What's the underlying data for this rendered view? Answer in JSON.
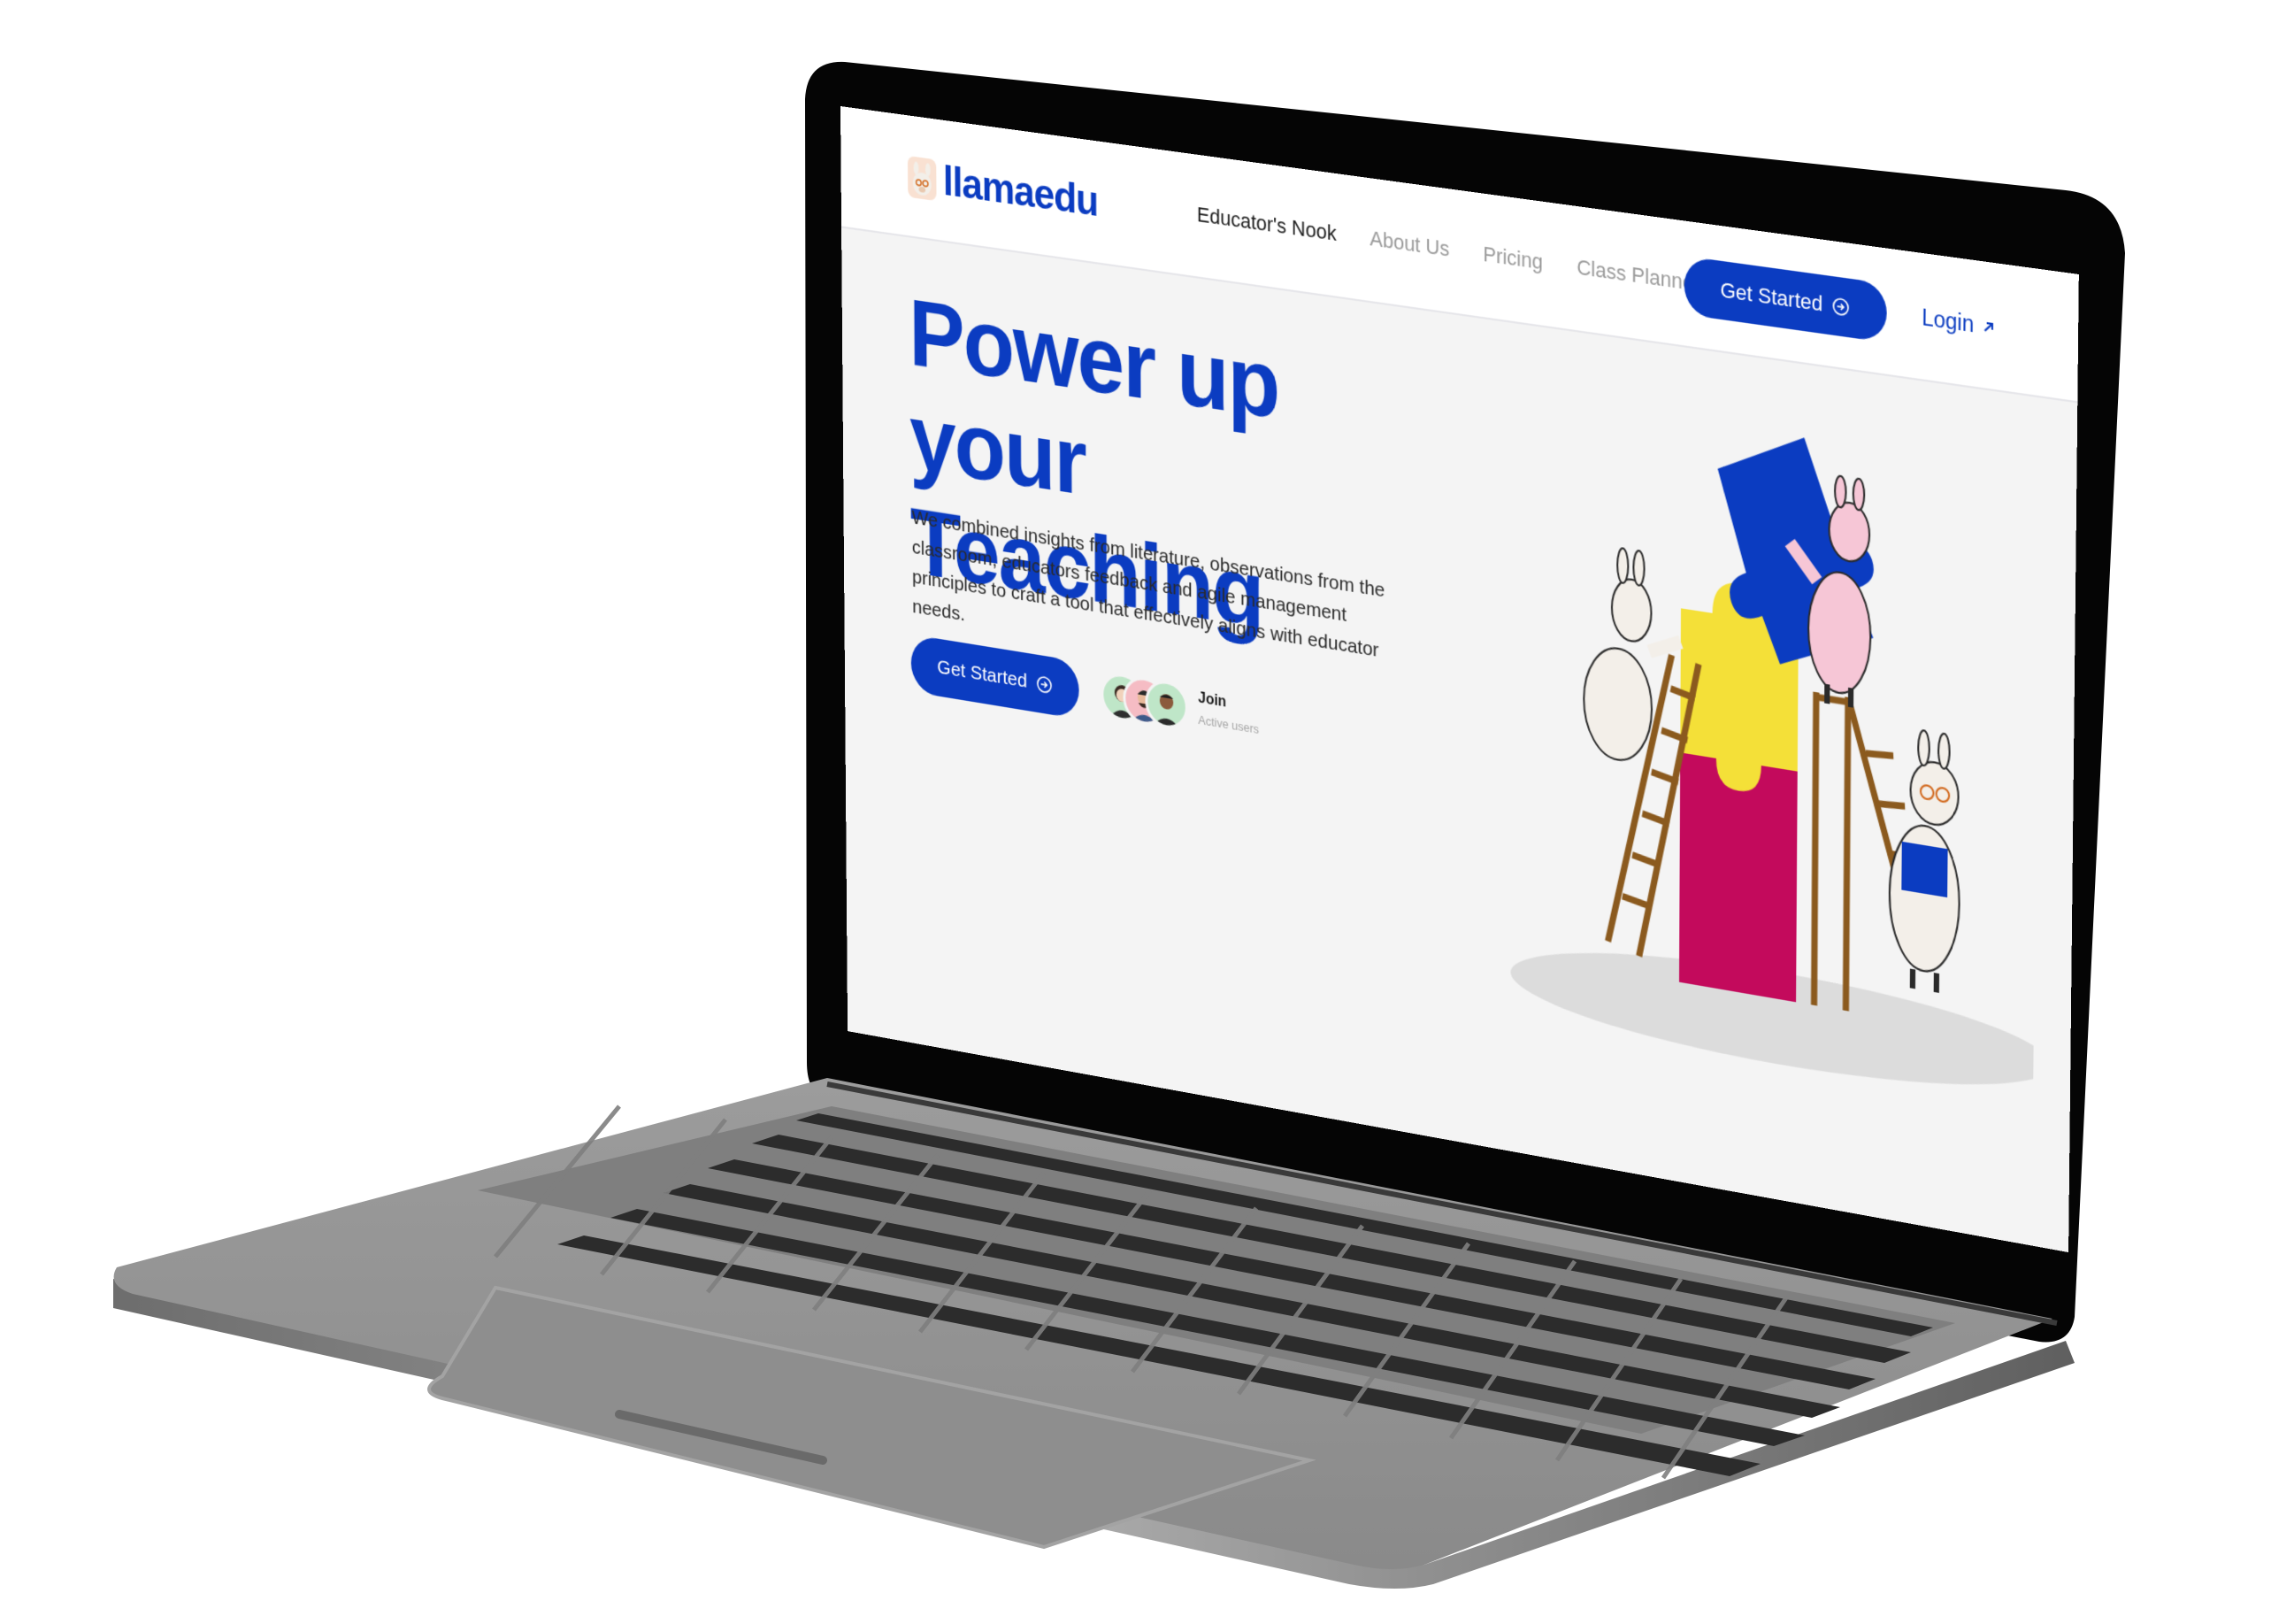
{
  "header": {
    "logo_text": "llamaedu",
    "nav": [
      {
        "label": "Educator's Nook",
        "active": true
      },
      {
        "label": "About Us",
        "active": false
      },
      {
        "label": "Pricing",
        "active": false
      },
      {
        "label": "Class Planner",
        "active": false
      }
    ],
    "get_started_label": "Get Started",
    "login_label": "Login"
  },
  "hero": {
    "title_line1": "Power up your",
    "title_line2": "Teaching",
    "description": "We combined insights from literature, observations from the classroom, educators feedback and agile management principles to craft a tool that effectively aligns with educator needs.",
    "cta_label": "Get Started",
    "join_label": "Join",
    "active_users_label": "Active users"
  },
  "colors": {
    "brand_blue": "#0b3cc1",
    "puzzle_yellow": "#f4e038",
    "puzzle_magenta": "#c30a5c",
    "llama_pink": "#f6c6d6",
    "screen_bg": "#f4f4f4"
  },
  "icons": {
    "cta_arrow": "circle-arrow-right-icon",
    "login_arrow": "arrow-up-right-icon"
  }
}
